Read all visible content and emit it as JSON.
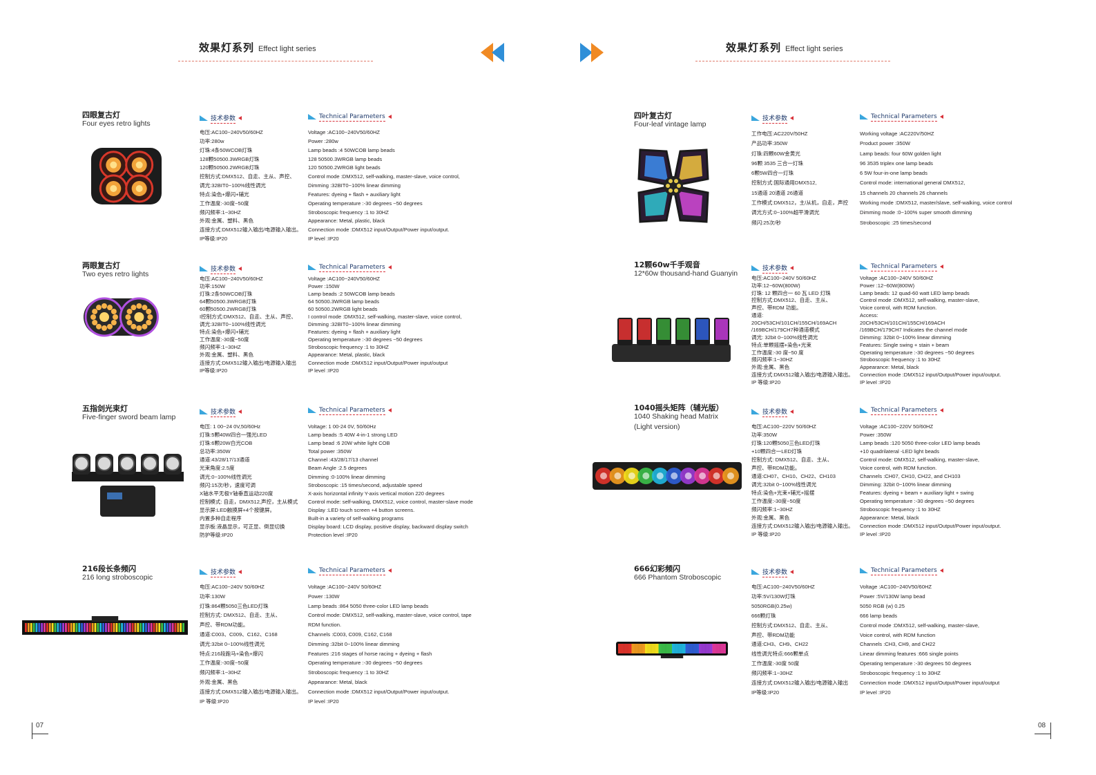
{
  "header": {
    "left": {
      "cn": "效果灯系列",
      "en": "Effect light series"
    },
    "right": {
      "cn": "效果灯系列",
      "en": "Effect light series"
    }
  },
  "labels": {
    "cn": "技术参数",
    "en": "Technical Parameters"
  },
  "pages": {
    "left": "07",
    "right": "08"
  },
  "products": [
    {
      "cn": "四眼复古灯",
      "en": [
        "Four eyes retro lights"
      ],
      "params_cn": [
        "电压:AC100~240V50/60HZ",
        "功率:280w",
        "灯珠:4条50WCOB灯珠",
        "128颗50500.3WRGB灯珠",
        "120颗50500.2WRGB灯珠",
        "控制方式:DMX512、自走、主从、声控、",
        "调光:32BIT0~100%线性调光",
        "特点:染色+爆闪+辅光",
        "工作温度:-30度~50度",
        "频闪频率:1~30HZ",
        "外观:金属、塑料、黑色",
        "连接方式:DMX512输入输出/电源输入输出。",
        "IP等级:IP20"
      ],
      "params_en": [
        "Voltage :AC100~240V50/60HZ",
        "Power :280w",
        "Lamp beads :4 50WCOB lamp beads",
        "128 50500.3WRGB lamp beads",
        "120 50500.2WRGB light beads",
        "Control mode :DMX512, self-walking, master-slave, voice control,",
        "Dimming :32BIT0~100% linear dimming",
        "Features: dyeing + flash + auxiliary light",
        "Operating temperature :-30 degrees ~50 degrees",
        "Stroboscopic frequency :1 to 30HZ",
        "Appearance: Metal, plastic, black",
        "Connection mode :DMX512 input/Output/Power input/output.",
        "IP level :IP20"
      ]
    },
    {
      "cn": "两眼复古灯",
      "en": [
        "Two eyes retro lights"
      ],
      "params_cn": [
        "电压:AC100~240V50/60HZ",
        "功率:150W",
        "灯珠:2条50WCOB灯珠",
        "64颗50500.3WRGB灯珠",
        "60颗50500.2WRGB灯珠",
        "I控制方式:DMX512、自走、主从、声控、",
        "调光:32BIT0~100%线性调光",
        "特点:染色+爆闪+辅光",
        "工作温度:-30度~50度",
        "频闪频率:1~30HZ",
        "外观:金属、塑料、黑色",
        "连接方式:DMX512输入输出/电源输入输出",
        "IP等级:IP20"
      ],
      "params_en": [
        "Voltage :AC100~240V50/60HZ",
        "Power :150W",
        "Lamp beads :2 50WCOB lamp beads",
        "64 50500.3WRGB lamp beads",
        "60 50500.2WRGB light beads",
        "I control mode :DMX512, self-walking, master-slave, voice control,",
        "Dimming :32BIT0~100% linear dimming",
        "Features: dyeing + flash + auxiliary light",
        "Operating temperature :-30 degrees ~50 degrees",
        "Stroboscopic frequency :1 to 30HZ",
        "Appearance: Metal, plastic, black",
        "Connection mode :DMX512 input/Output/Power input/output",
        "IP level :IP20"
      ]
    },
    {
      "cn": "五指剑光束灯",
      "en": [
        "Five-finger sword beam lamp"
      ],
      "params_cn": [
        "电压: 1 00~24 0V,50/60Hz",
        "灯珠:5颗40W四合一强光LED",
        "灯珠:6颗20W白光COB",
        "总功率:350W",
        "通道:43/28/17/13通道",
        "光束角度:2.5度",
        "调光:0~100%线性调光",
        "频闪:15次/秒，速度可调",
        "X轴水平无极Y轴垂直运动220度",
        "控制模式: 自走，DMX512,声控，主从模式",
        "显示屏:LED触摸屏+4个按键屏。",
        "内置多种自走程序",
        "显示板:液晶显示，可正显、倒显切换",
        "防护等级:IP20"
      ],
      "params_en": [
        "Voltage: 1 00-24 0V, 50/60Hz",
        "Lamp beads :5 40W 4-in-1 strong LED",
        "Lamp bead :6 20W white light COB",
        "Total power :350W",
        "Channel :43/28/17/13 channel",
        "Beam Angle :2.5 degrees",
        "Dimming :0-100% linear dimming",
        "Stroboscopic :15 times/second, adjustable speed",
        "X-axis horizontal infinity Y-axis vertical motion 220 degrees",
        "Control mode: self-walking, DMX512, voice control, master-slave mode",
        "Display :LED touch screen +4 button screens.",
        "Built-in a variety of self-walking programs",
        "Display board: LCD display, positive display, backward display switch",
        "Protection level :IP20"
      ]
    },
    {
      "cn": "216段长条频闪",
      "en": [
        "216 long stroboscopic"
      ],
      "params_cn": [
        "电压:AC100~240V 50/60HZ",
        "功率:130W",
        "灯珠:864颗5050三色LED灯珠",
        "控制方式: DMX512、自走、主从、",
        "声控、带RDM功能。",
        "通道:C003、C009、C162、C168",
        "调光:32bit 0~100%线性调光",
        "特点:216段跑马+染色+爆闪",
        "工作温度:-30度~50度",
        "频闪频率:1~30HZ",
        "外观:金属、黑色",
        "连接方式:DMX512输入输出/电源输入输出。",
        "IP 等级:IP20"
      ],
      "params_en": [
        "Voltage :AC100~240V 50/60HZ",
        "Power :130W",
        "Lamp beads :864 5050 three-color LED lamp beads",
        "Control mode: DMX512, self-walking, master-slave, voice control, tape",
        "RDM function.",
        "Channels :C003, C009, C162, C168",
        "Dimming :32bit 0~100% linear dimming",
        "Features :216 stages of horse racing + dyeing + flash",
        "Operating temperature :-30 degrees ~50 degrees",
        "Stroboscopic frequency :1 to 30HZ",
        "Appearance: Metal, black",
        "Connection mode :DMX512 input/Output/Power input/output.",
        "IP level :IP20"
      ]
    },
    {
      "cn": "四叶复古灯",
      "en": [
        "Four-leaf vintage lamp"
      ],
      "params_cn": [
        "工作电压:AC220V/50HZ",
        "产品功率:350W",
        "灯珠:四颗60W金黄光",
        "96颗 3535 三合一灯珠",
        "6颗5W四合一灯珠",
        "控制方式:国际通用DMX512,",
        "15通道 20通道 26通道",
        "工作模式:DMX512，主/从机，自走，声控",
        "调光方式:0~100%超平滑调光",
        "频闪:25次/秒"
      ],
      "params_en": [
        "Working voltage :AC220V/50HZ",
        "Product power :350W",
        "Lamp beads: four 60W golden light",
        "96 3535 triplex one lamp beads",
        "6 5W four-in-one lamp beads",
        "Control mode: international general DMX512,",
        "15 channels 20 channels 26 channels",
        "Working mode :DMX512, master/slave, self-walking, voice control",
        "Dimming mode :0~100% super smooth dimming",
        "Stroboscopic :25 times/second"
      ]
    },
    {
      "cn": "12颗60w千手观音",
      "en": [
        "12*60w thousand-hand Guanyin"
      ],
      "params_cn": [
        "电压:AC100~240V 50/60HZ",
        "功率:12~60W(800W)",
        "灯珠: 12 颗四合一 60 瓦 LED 灯珠",
        "控制方式:DMX512、自走、主从、",
        "声控、带RDM 功能。",
        "通道:",
        "20CH/53CH/101CH/155CH/169ACH",
        "/169BCH/179CH7种通道模式",
        "调光: 32bit 0~100%线性调光",
        "特点:单颗摇摆+染色+光束",
        "工作温度:-30 度~50 度",
        "频闪频率:1~30HZ",
        "外观:金属、黑色",
        "连接方式:DMX512输入输出/电源输入输出。",
        "IP 等级:IP20"
      ],
      "params_en": [
        "Voltage :AC100~240V 50/60HZ",
        "Power :12~60W(800W)",
        "Lamp beads: 12 quad-60 watt LED lamp beads",
        "Control mode :DMX512, self-walking, master-slave,",
        "Voice control, with RDM function.",
        "Access:",
        "20CH/53CH/101CH/155CH/169ACH",
        "/169BCH/179CH7 Indicates the channel mode",
        "Dimming: 32bit 0~100% linear dimming",
        "Features: Single swing + stain + beam",
        "Operating temperature :-30 degrees ~50 degrees",
        "Stroboscopic frequency :1 to 30HZ",
        "Appearance: Metal, black",
        "Connection mode :DMX512 input/Output/Power input/output.",
        "IP level :IP20"
      ]
    },
    {
      "cn": "1040摇头矩阵（辅光版）",
      "en": [
        "1040 Shaking head Matrix",
        "(Light version)"
      ],
      "params_cn": [
        "电压:AC100~220V 50/60HZ",
        "功率:350W",
        "灯珠:120颗5050三色LED灯珠",
        "+10颗四合一LED灯珠",
        "控制方式: DMX512、自走、主从、",
        "声控、带RDM功能。",
        "通道:CH07、CH10、CH22、CH103",
        "调光:32bit 0~100%线性调光",
        "特点:染色+光束+辅光+摇摆",
        "工作温度:-30度~50度",
        "频闪频率:1~30HZ",
        "外观:金属、黑色",
        "连接方式:DMX512输入输出/电源输入输出。",
        "IP 等级:IP20"
      ],
      "params_en": [
        "Voltage :AC100~220V 50/60HZ",
        "Power :350W",
        "Lamp beads :120 5050 three-color LED lamp beads",
        "+10 quadrilateral -LED light beads",
        "Control mode: DMX512, self-walking, master-slave,",
        "Voice control, with RDM function.",
        "Channels :CH07, CH10, CH22, and CH103",
        "Dimming: 32bit 0~100% linear dimming",
        "Features: dyeing + beam + auxiliary light + swing",
        "Operating temperature :-30 degrees ~50 degrees",
        "Stroboscopic frequency :1 to 30HZ",
        "Appearance: Metal, black",
        "Connection mode :DMX512 input/Output/Power input/output.",
        "IP level :IP20"
      ]
    },
    {
      "cn": "666幻彩频闪",
      "en": [
        "666 Phantom Stroboscopic"
      ],
      "params_cn": [
        "电压:AC100~240V50/60HZ",
        "功率:5V/130W灯珠",
        "5050RGB(0.25w)",
        "666颗灯珠",
        "控制方式:DMX512、自走、主从、",
        "声控、带RDM功能",
        "通道:CH3、CH9、CH22",
        "线性调光特点:666颗单点",
        "工作温度:-30度 50度",
        "频闪频率:1~30HZ",
        "连接方式:DMX512输入输出/电源输入输出",
        "IP等级:IP20"
      ],
      "params_en": [
        "Voltage :AC100~240V50/60HZ",
        "Power :5V/130W lamp bead",
        "5050 RGB (w) 0.25",
        "666 lamp beads",
        "Control mode :DMX512, self-walking, master-slave,",
        "Voice control, with RDM function",
        "Channels :CH3, CH9, and CH22",
        "Linear dimming features :666 single points",
        "Operating temperature :-30 degrees 50 degrees",
        "Stroboscopic frequency :1 to 30HZ",
        "Connection mode :DMX512 input/Output/Power input/output",
        "IP level :IP20"
      ]
    }
  ],
  "colors": {
    "accent_blue": "#3aa6dd",
    "accent_red": "#d83038",
    "accent_orange": "#f08a24",
    "dashed_line": "#e07a6a"
  },
  "icons": [
    "rewind-double-arrow-icon",
    "fast-forward-double-arrow-icon"
  ]
}
